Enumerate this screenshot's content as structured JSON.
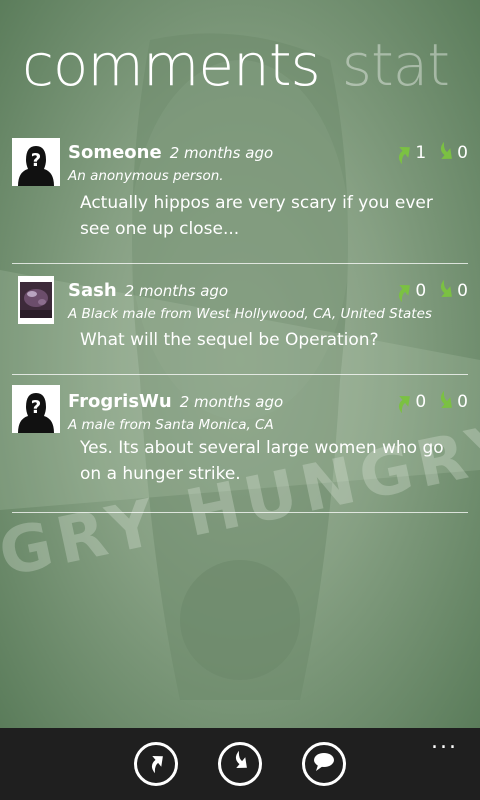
{
  "pivot": {
    "active_label": "comments",
    "next_label": "stat"
  },
  "comments": [
    {
      "username": "Someone",
      "time": "2 months ago",
      "description": "An anonymous person.",
      "text": "Actually hippos are very scary if you ever see one up close...",
      "up_votes": "1",
      "down_votes": "0",
      "avatar": "anonymous-avatar"
    },
    {
      "username": "Sash",
      "time": "2 months ago",
      "description": "A Black male from West Hollywood, CA, United States",
      "text": "What will the sequel be Operation?",
      "up_votes": "0",
      "down_votes": "0",
      "avatar": "photo-avatar"
    },
    {
      "username": "FrogrisWu",
      "time": "2 months ago",
      "description": "A male from Santa Monica, CA",
      "text": "Yes.  Its about several large women who go on a hunger strike.",
      "up_votes": "0",
      "down_votes": "0",
      "avatar": "anonymous-avatar"
    }
  ],
  "background_text": "GRY HUNGRY HI",
  "app_bar": {
    "buttons": [
      "thumbs-up-icon",
      "thumbs-down-icon",
      "comment-icon"
    ],
    "more": "..."
  },
  "colors": {
    "vote_up": "#7bc142",
    "vote_down": "#7bc142",
    "app_bar": "#1f1f1f"
  }
}
